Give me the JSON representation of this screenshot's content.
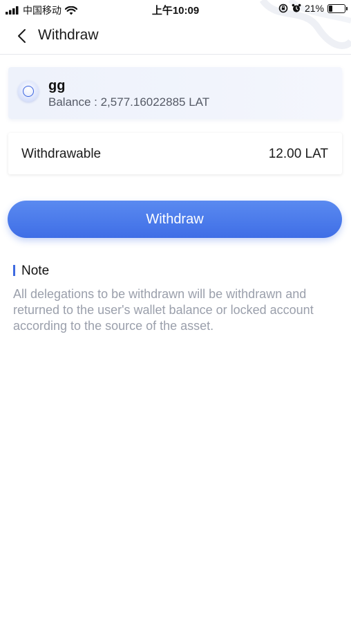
{
  "status_bar": {
    "carrier": "中国移动",
    "time": "上午10:09",
    "battery": "21%",
    "battery_level": 0.21
  },
  "nav": {
    "title": "Withdraw",
    "back_icon": "chevron-left-icon"
  },
  "wallet": {
    "name": "gg",
    "balance": "Balance : 2,577.16022885 LAT",
    "avatar_icon": "wallet-avatar-icon"
  },
  "withdrawable": {
    "label": "Withdrawable",
    "value": "12.00 LAT"
  },
  "action": {
    "withdraw_label": "Withdraw"
  },
  "note": {
    "title": "Note",
    "text": "All delegations to be withdrawn will be withdrawn and returned to the user's wallet balance or locked account according to the source of the asset."
  },
  "colors": {
    "accent": "#3f6ee6",
    "muted_text": "#9a9fab"
  }
}
